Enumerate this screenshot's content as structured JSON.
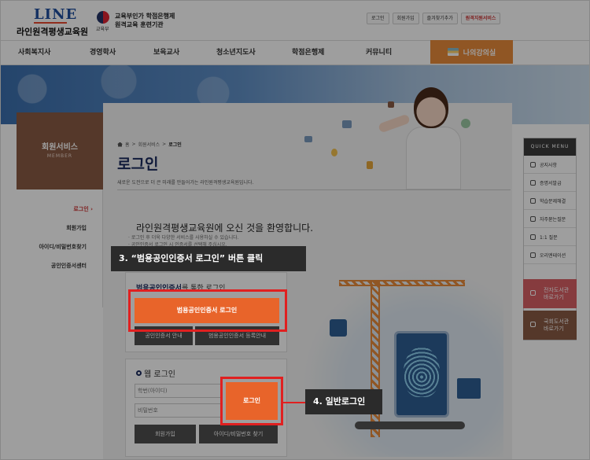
{
  "header": {
    "logo_mark": "LINE",
    "logo_name": "라인원격평생교육원",
    "gov_label": "교육부",
    "gov_line1": "교육부인가 학점은행제",
    "gov_line2": "원격교육 훈련기관",
    "toplinks": [
      "로그인",
      "회원가입",
      "즐겨찾기추가",
      "원격지원서비스"
    ]
  },
  "nav": {
    "items": [
      "사회복지사",
      "경영학사",
      "보육교사",
      "청소년지도사",
      "학점은행제",
      "커뮤니티"
    ],
    "my_classroom": "나의강의실"
  },
  "sidebar": {
    "title": "회원서비스",
    "subtitle": "MEMBER",
    "items": [
      "로그인",
      "회원가입",
      "아이디/비밀번호찾기",
      "공인인증서센터"
    ]
  },
  "breadcrumb": [
    "홈",
    "회원서비스",
    "로그인"
  ],
  "main": {
    "title": "로그인",
    "description": "새로운 도전으로 더 큰 미래를 만들어가는 라인원격평생교육원입니다.",
    "welcome": "라인원격평생교육원에 오신 것을 환영합니다.",
    "notes": [
      "· 로그인 후 더욱 다양한 서비스를 사용하실 수 있습니다.",
      "· 공인인증서 로그인 시 인증서를 선택해 주십시오."
    ]
  },
  "cert_login": {
    "title_bold": "범용공인인증서",
    "title_rest": "를 통한 로그인",
    "main_button": "범용공인인증서 로그인",
    "guide_button": "공인인증서 안내",
    "register_button": "범용공인인증서 등록안내"
  },
  "web_login": {
    "title": "웹 로그인",
    "id_placeholder": "학번(아이디)",
    "pw_placeholder": "비밀번호",
    "login_button": "로그인",
    "join_button": "회원가입",
    "find_button": "아이디/비밀번호 찾기"
  },
  "quick_menu": {
    "title": "QUICK MENU",
    "items": [
      "공지사항",
      "증명서발급",
      "학습문제해결",
      "자주묻는질문",
      "1:1 질문",
      "오리엔테이션"
    ],
    "library_1": [
      "전자도서관",
      "바로가기"
    ],
    "library_2": [
      "국회도서관",
      "바로가기"
    ]
  },
  "callouts": {
    "step3": "3. “범용공인인증서 로그인” 버튼 클릭",
    "step4": "4. 일반로그인"
  },
  "colors": {
    "accent_orange": "#e8642a",
    "highlight_red": "#e02020",
    "sidebar_brown": "#8a5b45",
    "title_navy": "#1b2a5e"
  }
}
